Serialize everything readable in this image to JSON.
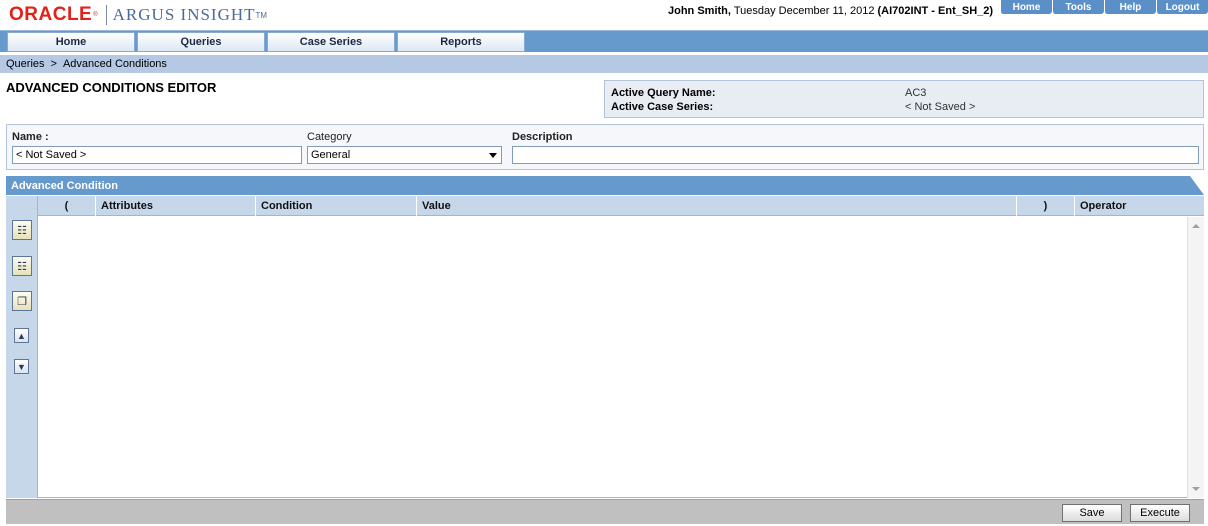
{
  "header": {
    "brand": "ORACLE",
    "product": "ARGUS INSIGHT",
    "product_tm": "TM",
    "user_name": "John Smith,",
    "date_text": "Tuesday December 11, 2012",
    "environment": "(AI702INT - Ent_SH_2)",
    "global_nav": [
      "Home",
      "Tools",
      "Help",
      "Logout"
    ]
  },
  "tabs": [
    "Home",
    "Queries",
    "Case Series",
    "Reports"
  ],
  "breadcrumb": {
    "parent": "Queries",
    "separator": ">",
    "current": "Advanced Conditions"
  },
  "page_title": "ADVANCED CONDITIONS EDITOR",
  "active_info": {
    "query_label": "Active Query Name:",
    "query_value": "AC3",
    "case_series_label": "Active Case Series:",
    "case_series_value": "< Not Saved >"
  },
  "form": {
    "name_label": "Name :",
    "name_value": "< Not Saved >",
    "category_label": "Category",
    "category_value": "General",
    "description_label": "Description",
    "description_value": ""
  },
  "advanced_condition": {
    "title": "Advanced Condition",
    "columns": [
      "(",
      "Attributes",
      "Condition",
      "Value",
      ")",
      "Operator"
    ],
    "rows": []
  },
  "toolbar_icons": [
    "add-condition-icon",
    "insert-condition-icon",
    "copy-condition-icon",
    "move-up-icon",
    "move-down-icon"
  ],
  "footer": {
    "save_label": "Save",
    "execute_label": "Execute"
  },
  "colors": {
    "primary_blue": "#6699cc",
    "breadcrumb_bg": "#b5c9e4",
    "oracle_red": "#e32119"
  }
}
